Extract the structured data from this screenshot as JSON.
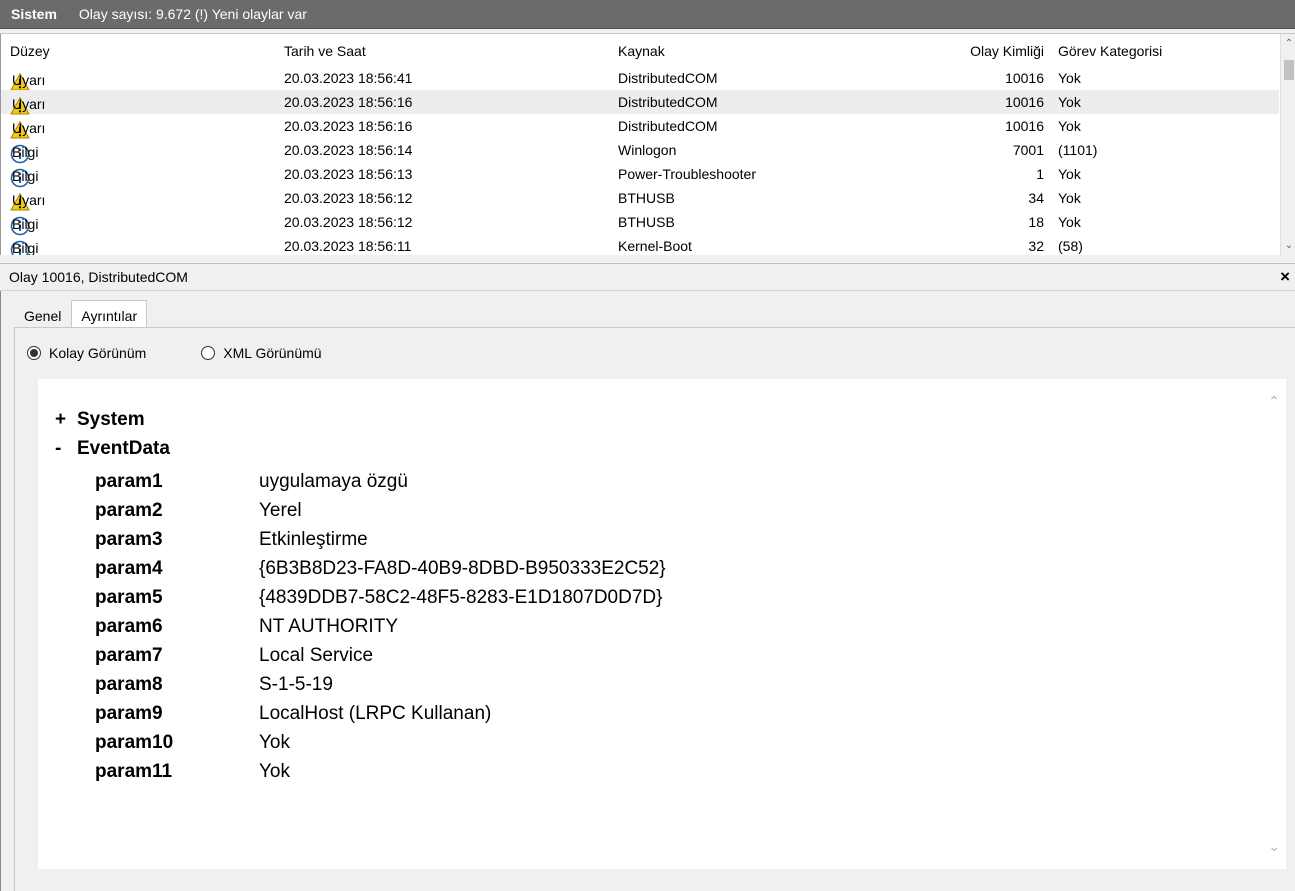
{
  "header": {
    "title": "Sistem",
    "subtitle": "Olay sayısı: 9.672 (!) Yeni olaylar var"
  },
  "columns": {
    "level": "Düzey",
    "date": "Tarih ve Saat",
    "source": "Kaynak",
    "event_id": "Olay Kimliği",
    "category": "Görev Kategorisi"
  },
  "rows": [
    {
      "type": "warning",
      "level": "Uyarı",
      "date": "20.03.2023 18:56:41",
      "source": "DistributedCOM",
      "event_id": "10016",
      "category": "Yok"
    },
    {
      "type": "warning",
      "level": "Uyarı",
      "date": "20.03.2023 18:56:16",
      "source": "DistributedCOM",
      "event_id": "10016",
      "category": "Yok",
      "selected": true
    },
    {
      "type": "warning",
      "level": "Uyarı",
      "date": "20.03.2023 18:56:16",
      "source": "DistributedCOM",
      "event_id": "10016",
      "category": "Yok"
    },
    {
      "type": "info",
      "level": "Bilgi",
      "date": "20.03.2023 18:56:14",
      "source": "Winlogon",
      "event_id": "7001",
      "category": "(1101)"
    },
    {
      "type": "info",
      "level": "Bilgi",
      "date": "20.03.2023 18:56:13",
      "source": "Power-Troubleshooter",
      "event_id": "1",
      "category": "Yok"
    },
    {
      "type": "warning",
      "level": "Uyarı",
      "date": "20.03.2023 18:56:12",
      "source": "BTHUSB",
      "event_id": "34",
      "category": "Yok"
    },
    {
      "type": "info",
      "level": "Bilgi",
      "date": "20.03.2023 18:56:12",
      "source": "BTHUSB",
      "event_id": "18",
      "category": "Yok"
    },
    {
      "type": "info",
      "level": "Bilgi",
      "date": "20.03.2023 18:56:11",
      "source": "Kernel-Boot",
      "event_id": "32",
      "category": "(58)"
    }
  ],
  "detail": {
    "title": "Olay 10016, DistributedCOM",
    "close": "×",
    "tabs": [
      "Genel",
      "Ayrıntılar"
    ],
    "active_tab": 1,
    "view_options": [
      "Kolay Görünüm",
      "XML Görünümü"
    ],
    "selected_view": 0,
    "tree": [
      {
        "toggle": "+",
        "label": "System"
      },
      {
        "toggle": "-",
        "label": "EventData"
      }
    ],
    "params": [
      {
        "name": "param1",
        "value": "uygulamaya özgü"
      },
      {
        "name": "param2",
        "value": "Yerel"
      },
      {
        "name": "param3",
        "value": "Etkinleştirme"
      },
      {
        "name": "param4",
        "value": "{6B3B8D23-FA8D-40B9-8DBD-B950333E2C52}"
      },
      {
        "name": "param5",
        "value": "{4839DDB7-58C2-48F5-8283-E1D1807D0D7D}"
      },
      {
        "name": "param6",
        "value": "NT AUTHORITY"
      },
      {
        "name": "param7",
        "value": "Local Service"
      },
      {
        "name": "param8",
        "value": "S-1-5-19"
      },
      {
        "name": "param9",
        "value": "LocalHost (LRPC Kullanan)"
      },
      {
        "name": "param10",
        "value": "Yok"
      },
      {
        "name": "param11",
        "value": "Yok"
      }
    ]
  },
  "colors": {
    "header_bg": "#6b6b6b",
    "warning": "#f2c811",
    "info": "#1f5fa8",
    "selected_row": "#ededed"
  }
}
